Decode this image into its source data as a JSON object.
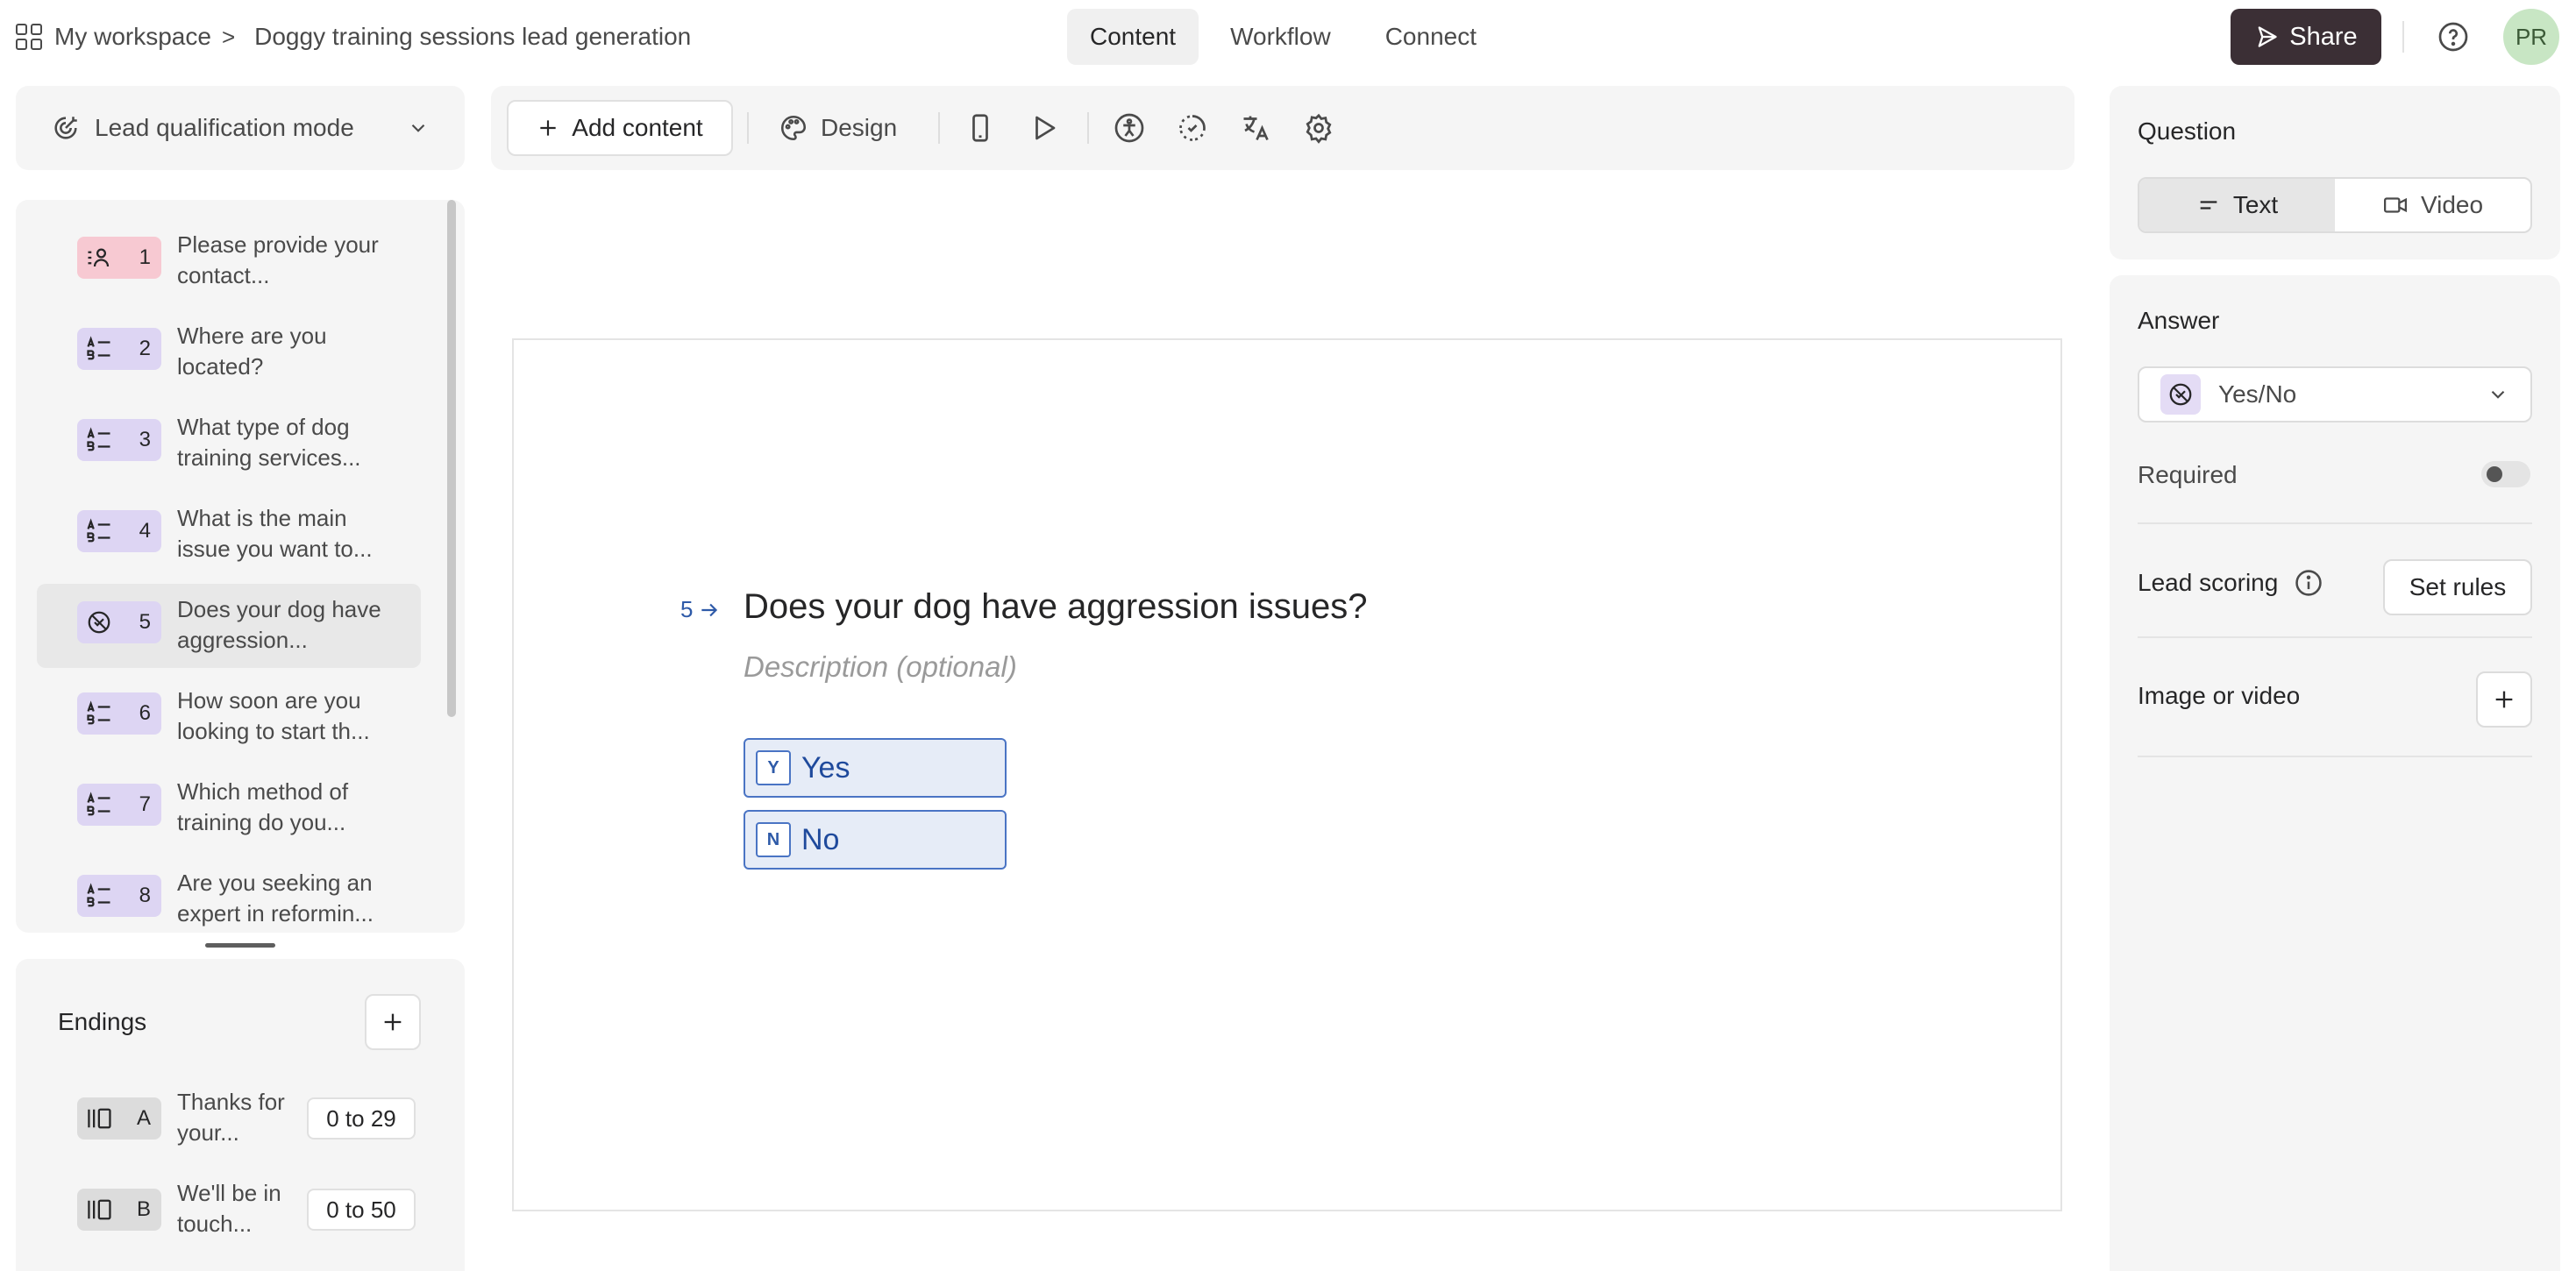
{
  "breadcrumb": {
    "workspace": "My workspace",
    "separator": ">",
    "form_title": "Doggy training sessions lead generation"
  },
  "nav_tabs": [
    "Content",
    "Workflow",
    "Connect"
  ],
  "header": {
    "share_label": "Share",
    "avatar_initials": "PR"
  },
  "mode": {
    "label": "Lead qualification mode"
  },
  "questions": [
    {
      "num": "1",
      "text": "Please provide your contact...",
      "icon": "contact-icon",
      "color": "#f7c9d2"
    },
    {
      "num": "2",
      "text": "Where are you located?",
      "icon": "multiple-choice-icon",
      "color": "#ddd5f3"
    },
    {
      "num": "3",
      "text": "What type of dog training services...",
      "icon": "multiple-choice-icon",
      "color": "#ddd5f3"
    },
    {
      "num": "4",
      "text": "What is the main issue you want to...",
      "icon": "multiple-choice-icon",
      "color": "#ddd5f3"
    },
    {
      "num": "5",
      "text": "Does your dog have aggression...",
      "icon": "yes-no-icon",
      "color": "#ddd5f3"
    },
    {
      "num": "6",
      "text": "How soon are you looking to start th...",
      "icon": "multiple-choice-icon",
      "color": "#ddd5f3"
    },
    {
      "num": "7",
      "text": "Which method of training do you...",
      "icon": "multiple-choice-icon",
      "color": "#ddd5f3"
    },
    {
      "num": "8",
      "text": "Are you seeking an expert in reformin...",
      "icon": "multiple-choice-icon",
      "color": "#ddd5f3"
    }
  ],
  "endings": {
    "title": "Endings",
    "items": [
      {
        "letter": "A",
        "text": "Thanks for your...",
        "range": "0 to 29"
      },
      {
        "letter": "B",
        "text": "We'll be in touch...",
        "range": "0 to 50"
      }
    ]
  },
  "toolbar": {
    "add_content": "Add content",
    "design": "Design"
  },
  "canvas": {
    "question_number": "5",
    "question_title": "Does your dog have aggression issues?",
    "description_placeholder": "Description (optional)",
    "choices": [
      {
        "key": "Y",
        "label": "Yes"
      },
      {
        "key": "N",
        "label": "No"
      }
    ]
  },
  "right_panel": {
    "question_heading": "Question",
    "question_types": [
      "Text",
      "Video"
    ],
    "answer_heading": "Answer",
    "answer_type": "Yes/No",
    "required_label": "Required",
    "required_on": false,
    "lead_scoring_label": "Lead scoring",
    "set_rules_label": "Set rules",
    "image_video_label": "Image or video"
  }
}
